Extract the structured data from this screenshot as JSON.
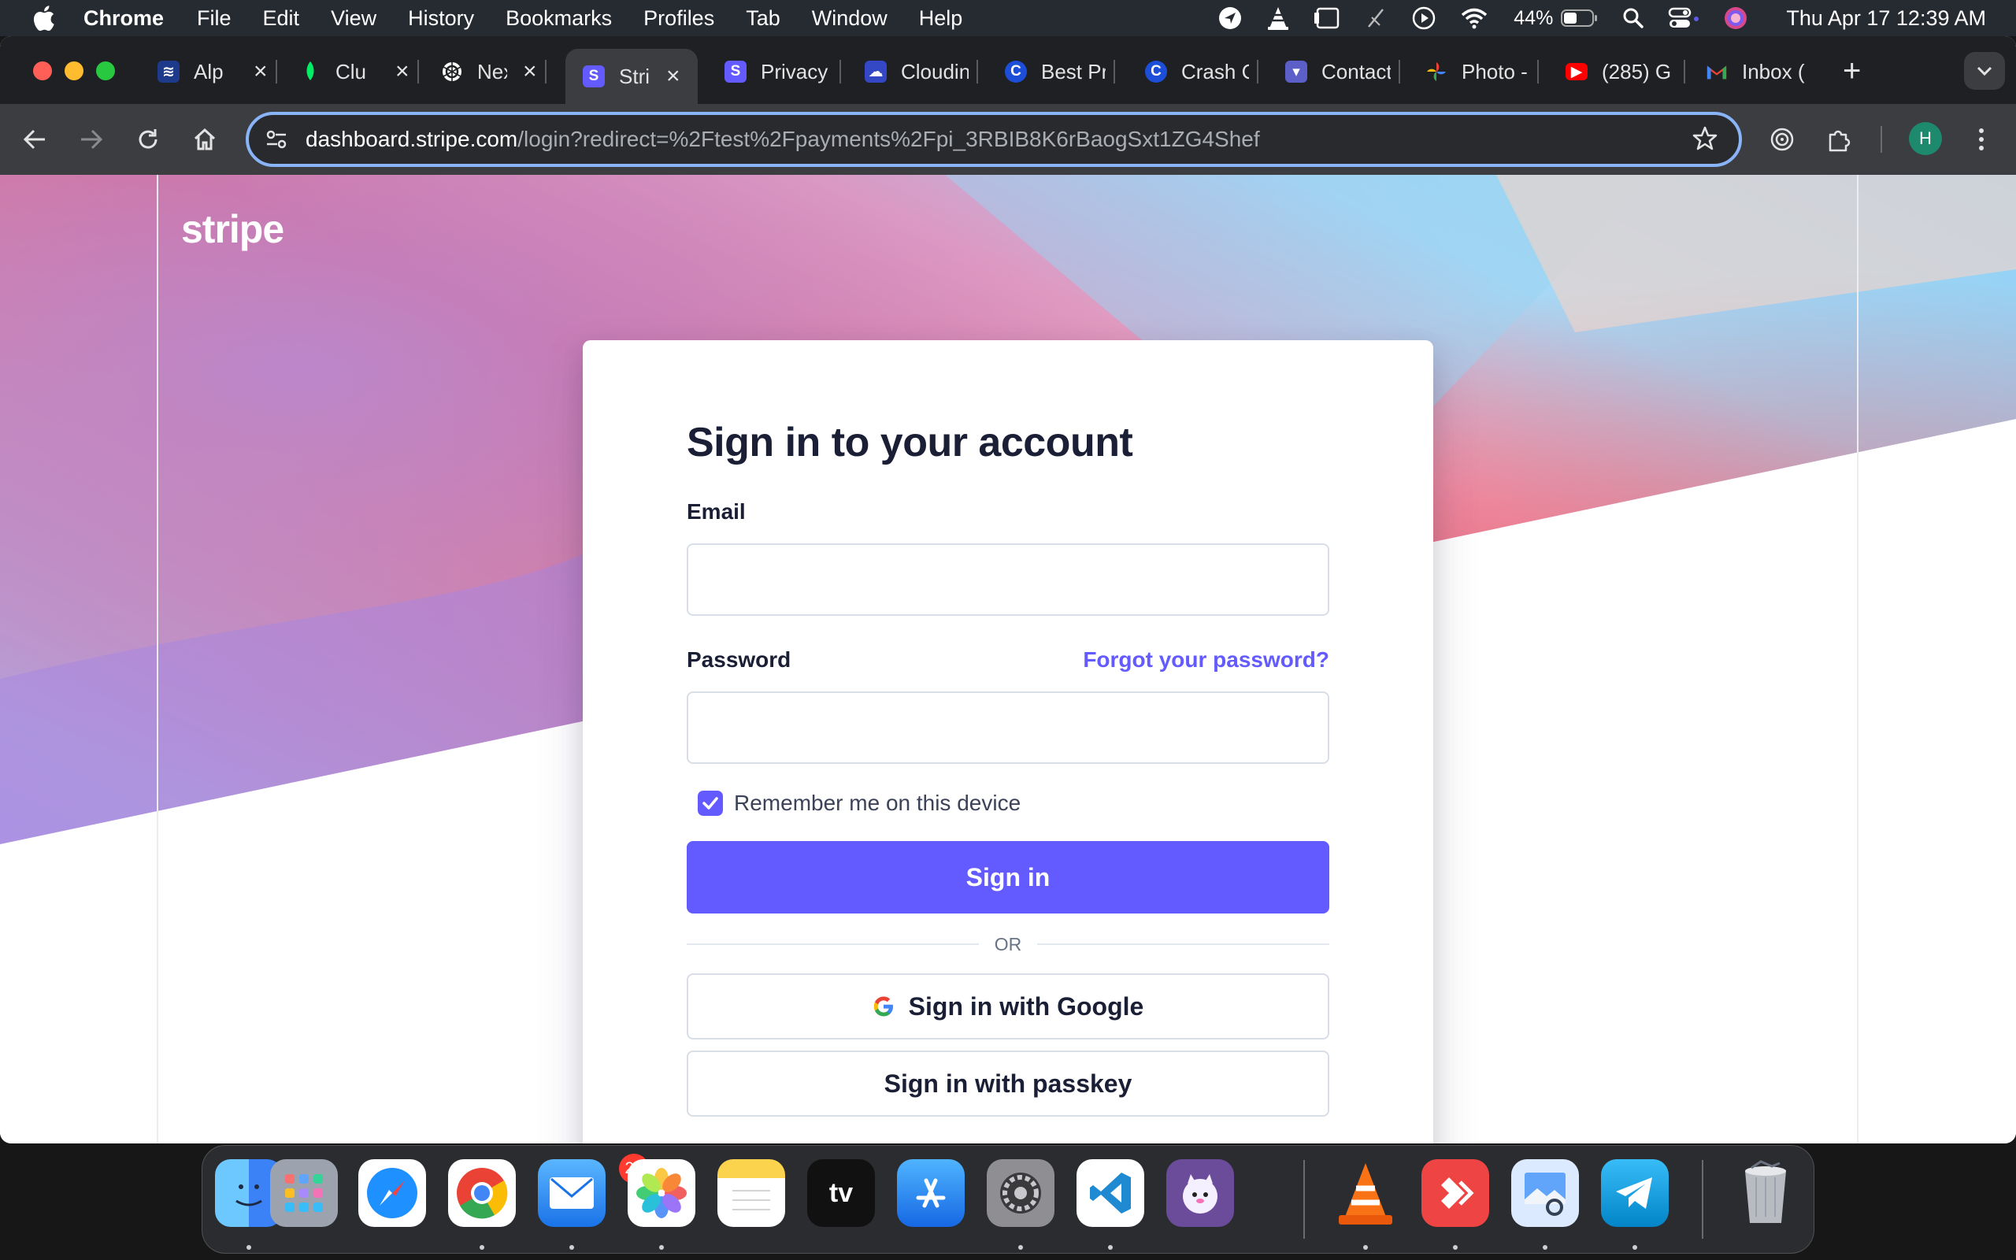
{
  "menubar": {
    "items": [
      "Chrome",
      "File",
      "Edit",
      "View",
      "History",
      "Bookmarks",
      "Profiles",
      "Tab",
      "Window",
      "Help"
    ],
    "battery": "44%",
    "clock": "Thu Apr 17  12:39 AM"
  },
  "tabs": [
    {
      "title": "Alp",
      "icon": "database-icon",
      "color": "#1e3a8a"
    },
    {
      "title": "Clu",
      "icon": "mongodb-leaf-icon",
      "color": "#00ed64"
    },
    {
      "title": "Nex",
      "icon": "openai-icon",
      "color": "#ffffff"
    },
    {
      "title": "Stri",
      "icon": "stripe-s-icon",
      "color": "#635bff",
      "active": true
    },
    {
      "title": "Privacy",
      "icon": "stripe-s-icon",
      "color": "#635bff"
    },
    {
      "title": "Cloudin",
      "icon": "cloudinary-icon",
      "color": "#3448c5"
    },
    {
      "title": "Best Pr",
      "icon": "c-logo-icon",
      "color": "#1d4ed8"
    },
    {
      "title": "Crash C",
      "icon": "c-logo-icon",
      "color": "#1d4ed8"
    },
    {
      "title": "Contact",
      "icon": "contact-icon",
      "color": "#5b5fc7"
    },
    {
      "title": "Photo -",
      "icon": "google-photos-icon",
      "color": "#fbbc05"
    },
    {
      "title": "(285) G",
      "icon": "youtube-icon",
      "color": "#ff0000"
    },
    {
      "title": "Inbox (",
      "icon": "gmail-icon",
      "color": "#ea4335"
    }
  ],
  "address_bar": {
    "host": "dashboard.stripe.com",
    "path": "/login?redirect=%2Ftest%2Fpayments%2Fpi_3RBIB8K6rBaogSxt1ZG4Shef"
  },
  "profile_initial": "H",
  "page": {
    "logo": "stripe",
    "title": "Sign in to your account",
    "email_label": "Email",
    "email_value": "",
    "password_label": "Password",
    "password_value": "",
    "forgot_link": "Forgot your password?",
    "remember_label": "Remember me on this device",
    "remember_checked": true,
    "signin_button": "Sign in",
    "divider": "OR",
    "google_button": "Sign in with Google",
    "passkey_button": "Sign in with passkey",
    "accent_color": "#635bff"
  },
  "dock": {
    "apps": [
      "Finder",
      "Launchpad",
      "Safari",
      "Google Chrome",
      "Mail",
      "Photos",
      "Notes",
      "Apple TV",
      "App Store",
      "System Settings",
      "Visual Studio Code",
      "Ollama",
      "VLC",
      "AnyDesk",
      "Preview",
      "Telegram",
      "Trash"
    ],
    "mail_badge": "20"
  }
}
